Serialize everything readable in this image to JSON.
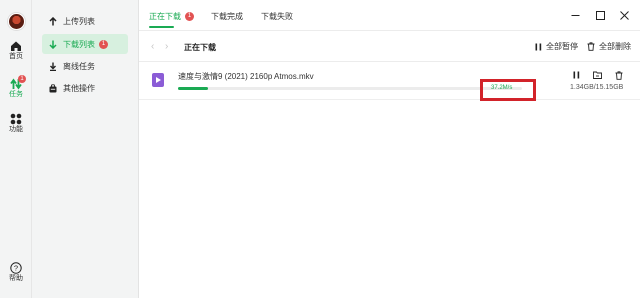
{
  "rail": {
    "home_label": "首页",
    "tasks_label": "任务",
    "tasks_badge": "1",
    "functions_label": "功能",
    "help_label": "帮助"
  },
  "sidebar": {
    "items": [
      {
        "label": "上传列表",
        "badge": ""
      },
      {
        "label": "下载列表",
        "badge": "1"
      },
      {
        "label": "离线任务",
        "badge": ""
      },
      {
        "label": "其他操作",
        "badge": ""
      }
    ]
  },
  "tabs": [
    {
      "label": "正在下载",
      "badge": "1"
    },
    {
      "label": "下载完成",
      "badge": ""
    },
    {
      "label": "下载失败",
      "badge": ""
    }
  ],
  "toolbar": {
    "title": "正在下载",
    "pause_all": "全部暂停",
    "delete_all": "全部删除"
  },
  "downloads": [
    {
      "name": "速度与激情9 (2021) 2160p Atmos.mkv",
      "speed": "37.2M/s",
      "size": "1.34GB/15.15GB",
      "progress": 0.0885
    }
  ],
  "colors": {
    "accent": "#1aaa53",
    "badge": "#e25353",
    "highlight": "#d2232a"
  }
}
